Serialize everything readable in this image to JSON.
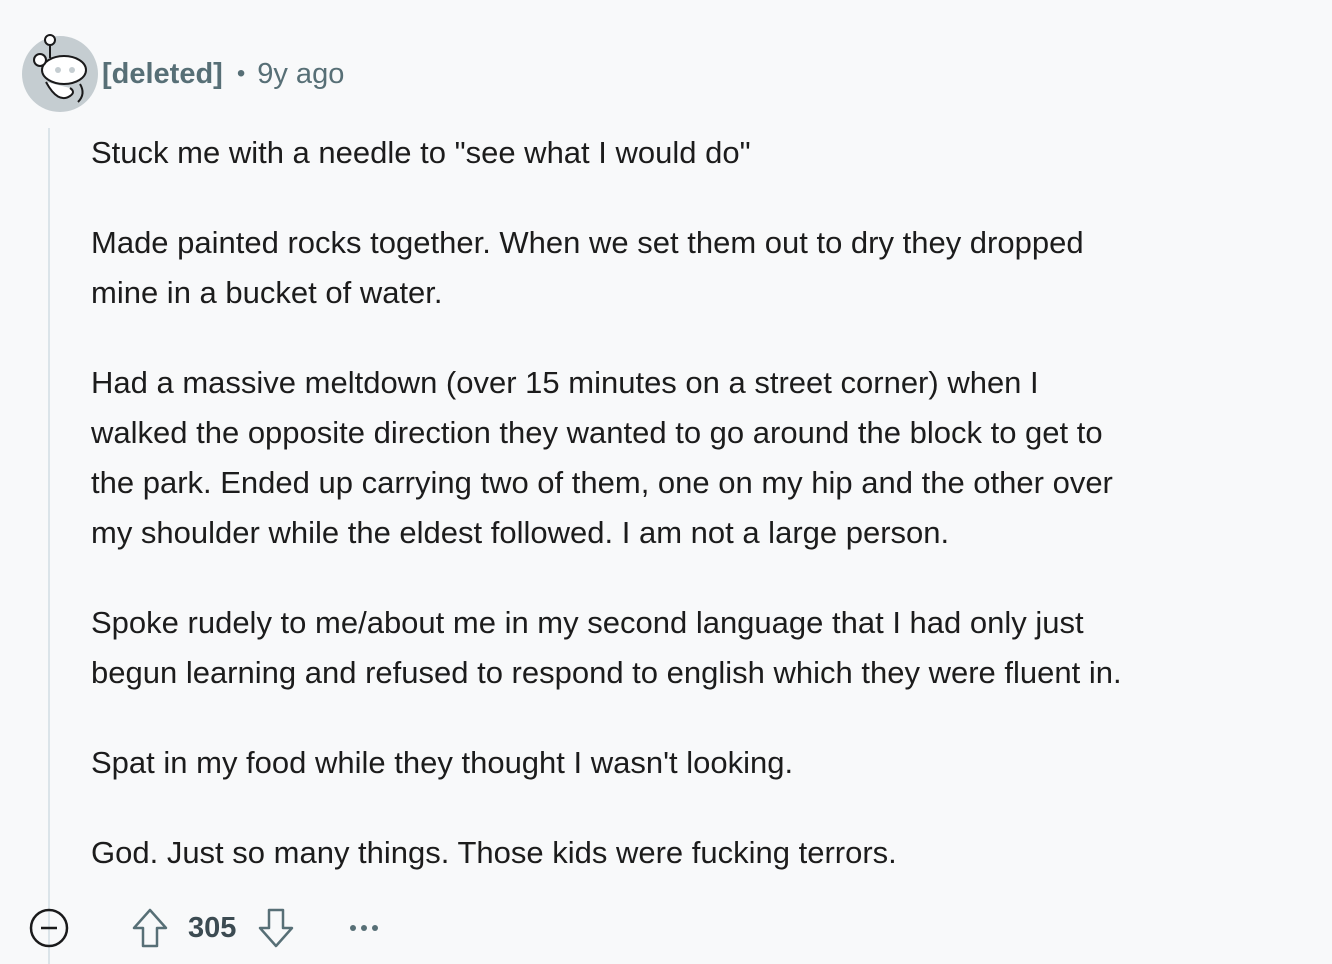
{
  "comment": {
    "author": "[deleted]",
    "separator": "•",
    "age": "9y ago",
    "avatar_icon": "deleted-user-snoo-icon",
    "paragraphs": [
      {
        "lines": [
          "Stuck me with a needle to \"see what I would do\""
        ]
      },
      {
        "lines": [
          "Made painted rocks together. When we set them out to dry they dropped",
          "mine in a bucket of water."
        ]
      },
      {
        "lines": [
          "Had a massive meltdown (over 15 minutes on a street corner) when I",
          "walked the opposite direction they wanted to go around the block to get to",
          "the park. Ended up carrying two of them, one on my hip and the other over",
          "my shoulder while the eldest followed. I am not a large person."
        ]
      },
      {
        "lines": [
          "Spoke rudely to me/about me in my second language that I had only just",
          "begun learning and refused to respond to english which they were fluent in."
        ]
      },
      {
        "lines": [
          "Spat in my food while they thought I wasn't looking."
        ]
      },
      {
        "lines": [
          "God. Just so many things. Those kids were fucking terrors."
        ]
      }
    ]
  },
  "actions": {
    "collapse_icon": "collapse-minus-icon",
    "upvote_icon": "upvote-arrow-icon",
    "score": "305",
    "downvote_icon": "downvote-arrow-icon",
    "more_icon": "more-options-icon"
  },
  "colors": {
    "background": "#f8f9fa",
    "meta_text": "#576f76",
    "body_text": "#1c1c1c",
    "thread_line": "#dbe4e9"
  }
}
